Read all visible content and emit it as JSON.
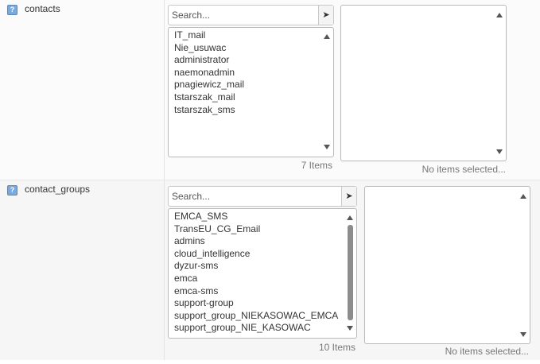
{
  "contacts": {
    "label": "contacts",
    "help_icon": "question-mark-icon",
    "search_placeholder": "Search...",
    "search_button_icon": "arrow-right-icon",
    "available_items": [
      "IT_mail",
      "Nie_usuwac",
      "administrator",
      "naemonadmin",
      "pnagiewicz_mail",
      "tstarszak_mail",
      "tstarszak_sms"
    ],
    "available_count": "7 Items",
    "selected_items": [],
    "selected_count": "No items selected..."
  },
  "contact_groups": {
    "label": "contact_groups",
    "help_icon": "question-mark-icon",
    "search_placeholder": "Search...",
    "search_button_icon": "arrow-right-icon",
    "available_items": [
      "EMCA_SMS",
      "TransEU_CG_Email",
      "admins",
      "cloud_intelligence",
      "dyzur-sms",
      "emca",
      "emca-sms",
      "support-group",
      "support_group_NIEKASOWAC_EMCA",
      "support_group_NIE_KASOWAC"
    ],
    "available_count": "10 Items",
    "selected_items": [],
    "selected_count": "No items selected..."
  }
}
